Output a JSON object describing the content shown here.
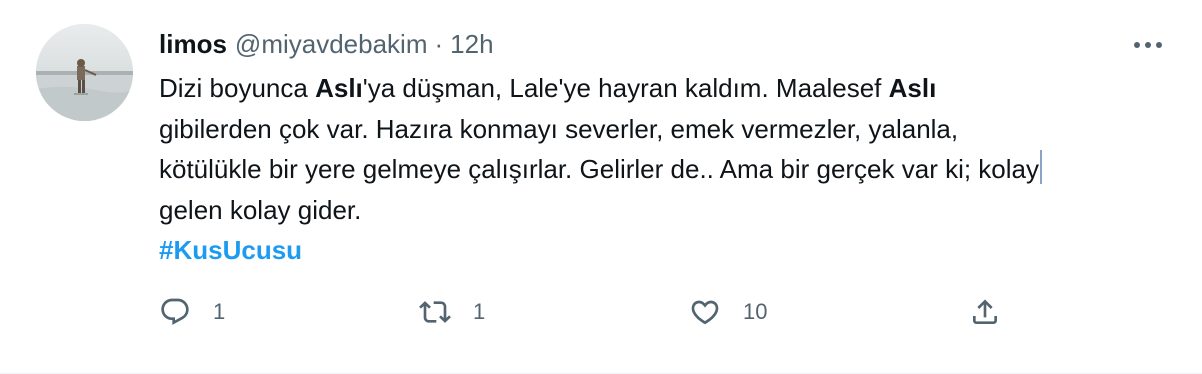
{
  "tweet": {
    "author": {
      "name": "limos",
      "handle": "@miyavdebakim"
    },
    "separator": "·",
    "time": "12h",
    "text": {
      "line1_a": "Dizi boyunca ",
      "line1_b": "Aslı",
      "line1_c": "'ya düşman, Lale'ye hayran kaldım. Maalesef ",
      "line1_d": "Aslı",
      "line2": "gibilerden çok var. Hazıra konmayı severler, emek vermezler, yalanla,",
      "line3": "kötülükle bir yere gelmeye çalışırlar. Gelirler de.. Ama bir gerçek var ki; kolay",
      "line4": "gelen kolay gider.",
      "hashtag": "#KusUcusu"
    },
    "actions": {
      "reply_count": "1",
      "retweet_count": "1",
      "like_count": "10"
    }
  },
  "colors": {
    "text": "#0f1419",
    "secondary": "#536471",
    "link": "#1d9bf0",
    "divider": "#eff3f4"
  },
  "icons": [
    "more-icon",
    "reply-icon",
    "retweet-icon",
    "like-icon",
    "share-icon"
  ]
}
